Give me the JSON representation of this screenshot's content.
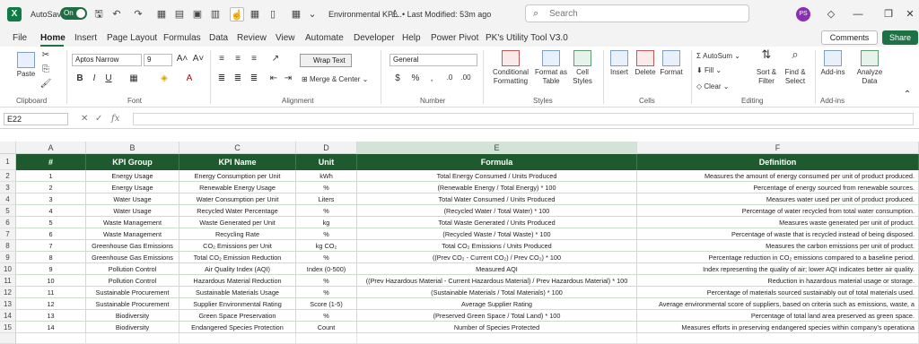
{
  "titlebar": {
    "logo": "X",
    "autosave_label": "AutoSave",
    "autosave_state": "On",
    "title": "Environmental KPI...",
    "status": "• Last Modified: 53m ago",
    "search_placeholder": "Search",
    "avatar_initials": "PS"
  },
  "menu": {
    "tabs": [
      "File",
      "Home",
      "Insert",
      "Page Layout",
      "Formulas",
      "Data",
      "Review",
      "View",
      "Automate",
      "Developer",
      "Help",
      "Power Pivot",
      "PK's Utility Tool V3.0"
    ],
    "active": "Home",
    "comments_label": "Comments",
    "share_label": "Share"
  },
  "ribbon": {
    "paste_label": "Paste",
    "font_name": "Aptos Narrow",
    "font_size": "9",
    "wrap_text": "Wrap Text",
    "merge_center": "Merge & Center",
    "number_format": "General",
    "conditional_formatting_1": "Conditional",
    "conditional_formatting_2": "Formatting",
    "format_as_table_1": "Format as",
    "format_as_table_2": "Table",
    "cell_styles_1": "Cell",
    "cell_styles_2": "Styles",
    "insert_label": "Insert",
    "delete_label": "Delete",
    "format_label": "Format",
    "autosum_label": "AutoSum",
    "fill_label": "Fill",
    "clear_label": "Clear",
    "sort_filter_1": "Sort &",
    "sort_filter_2": "Filter",
    "find_select_1": "Find &",
    "find_select_2": "Select",
    "addins_label": "Add-ins",
    "analyze_1": "Analyze",
    "analyze_2": "Data",
    "groups": [
      "Clipboard",
      "Font",
      "Alignment",
      "Number",
      "Styles",
      "Cells",
      "Editing",
      "Add-ins"
    ]
  },
  "formula_bar": {
    "name_box": "E22",
    "fx": "fx",
    "value": ""
  },
  "sheet": {
    "columns": [
      "A",
      "B",
      "C",
      "D",
      "E",
      "F"
    ],
    "selected_column": "E",
    "row_numbers": [
      "1",
      "2",
      "3",
      "4",
      "5",
      "6",
      "7",
      "8",
      "9",
      "10",
      "11",
      "12",
      "13",
      "14",
      "15"
    ],
    "headers": [
      "#",
      "KPI Group",
      "KPI Name",
      "Unit",
      "Formula",
      "Definition"
    ],
    "rows": [
      [
        "1",
        "Energy Usage",
        "Energy Consumption per Unit",
        "kWh",
        "Total Energy Consumed / Units Produced",
        "Measures the amount of energy consumed per unit of product produced."
      ],
      [
        "2",
        "Energy Usage",
        "Renewable Energy Usage",
        "%",
        "(Renewable Energy / Total Energy) * 100",
        "Percentage of energy sourced from renewable sources."
      ],
      [
        "3",
        "Water Usage",
        "Water Consumption per Unit",
        "Liters",
        "Total Water Consumed / Units Produced",
        "Measures water used per unit of product produced."
      ],
      [
        "4",
        "Water Usage",
        "Recycled Water Percentage",
        "%",
        "(Recycled Water / Total Water) * 100",
        "Percentage of water recycled from total water consumption."
      ],
      [
        "5",
        "Waste Management",
        "Waste Generated per Unit",
        "kg",
        "Total Waste Generated / Units Produced",
        "Measures waste generated per unit of product."
      ],
      [
        "6",
        "Waste Management",
        "Recycling Rate",
        "%",
        "(Recycled Waste / Total Waste) * 100",
        "Percentage of waste that is recycled instead of being disposed."
      ],
      [
        "7",
        "Greenhouse Gas Emissions",
        "CO₂ Emissions per Unit",
        "kg CO₂",
        "Total CO₂ Emissions / Units Produced",
        "Measures the carbon emissions per unit of product."
      ],
      [
        "8",
        "Greenhouse Gas Emissions",
        "Total CO₂ Emission Reduction",
        "%",
        "((Prev CO₂ - Current CO₂) / Prev CO₂) * 100",
        "Percentage reduction in CO₂ emissions compared to a baseline period."
      ],
      [
        "9",
        "Pollution Control",
        "Air Quality Index (AQI)",
        "Index (0-500)",
        "Measured AQI",
        "Index representing the quality of air; lower AQI indicates better air quality."
      ],
      [
        "10",
        "Pollution Control",
        "Hazardous Material Reduction",
        "%",
        "((Prev Hazardous Material - Current Hazardous Material) / Prev Hazardous Material) * 100",
        "Reduction in hazardous material usage or storage."
      ],
      [
        "11",
        "Sustainable Procurement",
        "Sustainable Materials Usage",
        "%",
        "(Sustainable Materials / Total Materials) * 100",
        "Percentage of materials sourced sustainably out of total materials used."
      ],
      [
        "12",
        "Sustainable Procurement",
        "Supplier Environmental Rating",
        "Score (1-5)",
        "Average Supplier Rating",
        "Average environmental score of suppliers, based on criteria such as emissions, waste, a"
      ],
      [
        "13",
        "Biodiversity",
        "Green Space Preservation",
        "%",
        "(Preserved Green Space / Total Land) * 100",
        "Percentage of total land area preserved as green space."
      ],
      [
        "14",
        "Biodiversity",
        "Endangered Species Protection",
        "Count",
        "Number of Species Protected",
        "Measures efforts in preserving endangered species within company's operationa"
      ]
    ]
  },
  "colors": {
    "header_green": "#1f5a2e",
    "accent": "#1e7145"
  }
}
